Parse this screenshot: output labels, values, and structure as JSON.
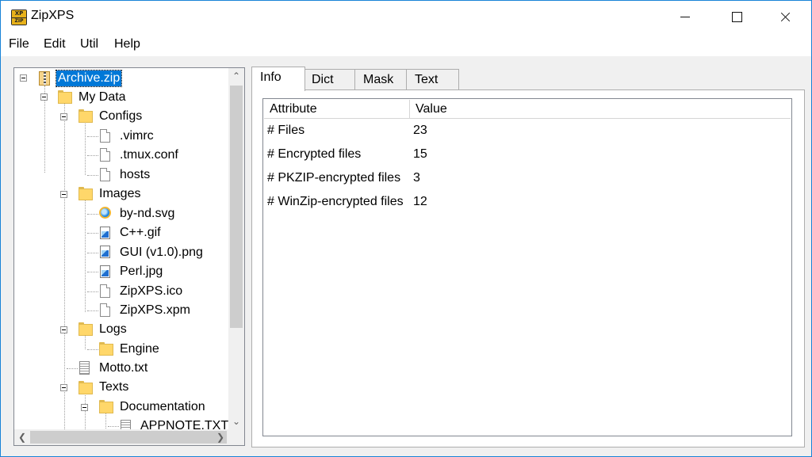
{
  "window": {
    "title": "ZipXPS"
  },
  "menu": [
    "File",
    "Edit",
    "Util",
    "Help"
  ],
  "tree": {
    "root": "Archive.zip",
    "nodes": [
      {
        "label": "My Data",
        "icon": "folder-icon"
      },
      {
        "label": "Configs",
        "icon": "folder-icon"
      },
      {
        "label": ".vimrc",
        "icon": "file-icon"
      },
      {
        "label": ".tmux.conf",
        "icon": "file-icon"
      },
      {
        "label": "hosts",
        "icon": "file-icon"
      },
      {
        "label": "Images",
        "icon": "folder-icon"
      },
      {
        "label": "by-nd.svg",
        "icon": "svg-file-icon"
      },
      {
        "label": "C++.gif",
        "icon": "image-file-icon"
      },
      {
        "label": "GUI (v1.0).png",
        "icon": "image-file-icon"
      },
      {
        "label": "Perl.jpg",
        "icon": "image-file-icon"
      },
      {
        "label": "ZipXPS.ico",
        "icon": "file-icon"
      },
      {
        "label": "ZipXPS.xpm",
        "icon": "file-icon"
      },
      {
        "label": "Logs",
        "icon": "folder-icon"
      },
      {
        "label": "Engine",
        "icon": "folder-icon"
      },
      {
        "label": "Motto.txt",
        "icon": "text-file-icon"
      },
      {
        "label": "Texts",
        "icon": "folder-icon"
      },
      {
        "label": "Documentation",
        "icon": "folder-icon"
      },
      {
        "label": "APPNOTE.TXT",
        "icon": "text-file-icon"
      }
    ]
  },
  "tabs": [
    "Info",
    "Dict",
    "Mask",
    "Text"
  ],
  "info_table": {
    "columns": [
      "Attribute",
      "Value"
    ],
    "rows": [
      {
        "attribute": "# Files",
        "value": "23"
      },
      {
        "attribute": "# Encrypted files",
        "value": "15"
      },
      {
        "attribute": "# PKZIP-encrypted files",
        "value": "3"
      },
      {
        "attribute": "# WinZip-encrypted files",
        "value": "12"
      }
    ]
  },
  "colors": {
    "selection": "#0078d7",
    "window_border": "#1883d7",
    "folder": "#ffd76a"
  }
}
